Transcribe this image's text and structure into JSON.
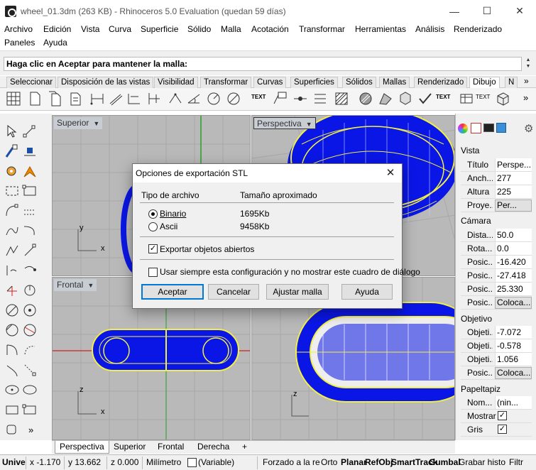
{
  "window": {
    "title": "wheel_01.3dm (263 KB) - Rhinoceros 5.0 Evaluation (quedan 59 días)",
    "minimize": "—",
    "maximize": "☐",
    "close": "✕"
  },
  "menu": {
    "row1": [
      "Archivo",
      "Edición",
      "Vista",
      "Curva",
      "Superficie",
      "Sólido",
      "Malla",
      "Acotación",
      "Transformar",
      "Herramientas",
      "Análisis",
      "Renderizado"
    ],
    "row2": [
      "Paneles",
      "Ayuda"
    ]
  },
  "command": {
    "prompt": "Haga clic en Aceptar para mantener la malla:",
    "scroll_up": "▲",
    "scroll_down": "▼"
  },
  "toolbar_tabs": [
    "Seleccionar",
    "Disposición de las vistas",
    "Visibilidad",
    "Transformar",
    "Curvas",
    "Superficies",
    "Sólidos",
    "Mallas",
    "Renderizado",
    "Dibujo",
    "N"
  ],
  "toolbar_tabs_more": "»",
  "toolbar": {
    "text_icon_label": "TEXT",
    "text2_label": "TEXT",
    "text3_label": "TEXT",
    "more": "»"
  },
  "viewports": {
    "top": {
      "title": "Superior",
      "axis_x": "x",
      "axis_y": "y"
    },
    "perspective": {
      "title": "Perspectiva"
    },
    "front": {
      "title": "Frontal",
      "axis_x": "x",
      "axis_z": "z"
    },
    "right_axis_z": "z"
  },
  "viewport_tabs": [
    "Perspectiva",
    "Superior",
    "Frontal",
    "Derecha"
  ],
  "viewport_tabs_add": "+",
  "panel": {
    "view_section": "Vista",
    "view_rows": [
      {
        "label": "Título",
        "value": "Perspe..."
      },
      {
        "label": "Anch...",
        "value": "277"
      },
      {
        "label": "Altura",
        "value": "225"
      },
      {
        "label": "Proye...",
        "value": "Per..."
      }
    ],
    "camera_section": "Cámara",
    "camera_rows": [
      {
        "label": "Dista...",
        "value": "50.0"
      },
      {
        "label": "Rota...",
        "value": "0.0"
      },
      {
        "label": "Posic...",
        "value": "-16.420"
      },
      {
        "label": "Posic...",
        "value": "-27.418"
      },
      {
        "label": "Posic...",
        "value": "25.330"
      },
      {
        "label": "Posic...",
        "value": "Coloca..."
      }
    ],
    "target_section": "Objetivo",
    "target_rows": [
      {
        "label": "Objeti...",
        "value": "-7.072"
      },
      {
        "label": "Objeti...",
        "value": "-0.578"
      },
      {
        "label": "Objeti...",
        "value": "1.056"
      },
      {
        "label": "Posic...",
        "value": "Coloca..."
      }
    ],
    "wallpaper_section": "Papeltapiz",
    "wallpaper_rows": [
      {
        "label": "Nom...",
        "value": "(nin..."
      },
      {
        "label": "Mostrar",
        "value": "✓"
      },
      {
        "label": "Gris",
        "value": "✓"
      }
    ]
  },
  "statusbar": {
    "units": "Unive",
    "x": "x -1.170",
    "y": "y 13.662",
    "z": "z 0.000",
    "mm": "Milímetro",
    "layer": "(Variable)",
    "osnap_grid": "Forzado a la re",
    "ortho": "Orto",
    "planar": "Planar",
    "refobj": "RefObj",
    "smarttrack": "SmartTrack",
    "gumball": "Gumbal",
    "history": "Grabar histo",
    "filter": "Filtr"
  },
  "dialog": {
    "title": "Opciones de exportación STL",
    "close": "✕",
    "col_type": "Tipo de archivo",
    "col_size": "Tamaño aproximado",
    "options": [
      {
        "label": "Binario",
        "size": "1695Kb",
        "selected": true
      },
      {
        "label": "Ascii",
        "size": "9458Kb",
        "selected": false
      }
    ],
    "export_open": "Exportar objetos abiertos",
    "export_open_checked": true,
    "always_use": "Usar siempre esta configuración y no mostrar este cuadro de diálogo",
    "always_use_checked": false,
    "buttons": {
      "ok": "Aceptar",
      "cancel": "Cancelar",
      "adjust": "Ajustar malla",
      "help": "Ayuda"
    }
  },
  "colors": {
    "viewport_bg": "#b9b9b9",
    "grid_line": "#a5a5a5",
    "mesh_blue": "#0a16e6",
    "curve_yellow": "#f1ef44",
    "accent": "#0078d7"
  }
}
